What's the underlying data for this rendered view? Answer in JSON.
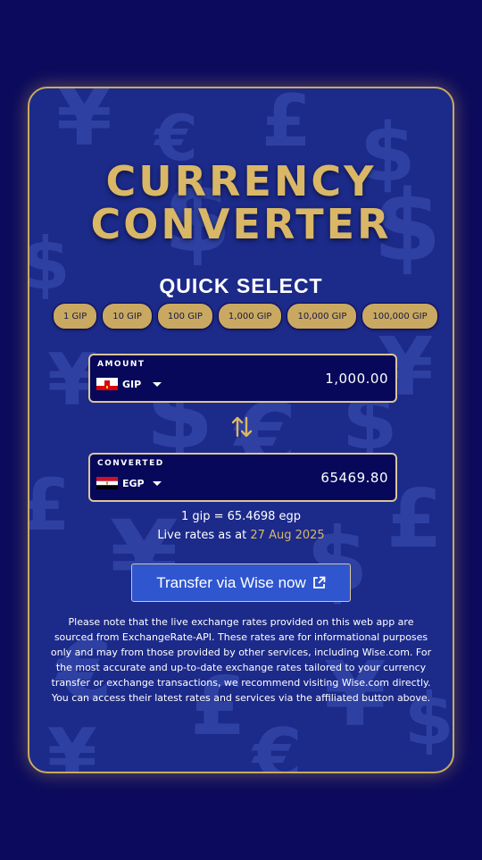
{
  "app": {
    "title_line1": "CURRENCY",
    "title_line2": "CONVERTER"
  },
  "quick_select": {
    "heading": "QUICK SELECT",
    "options": [
      "1 GIP",
      "10 GIP",
      "100 GIP",
      "1,000 GIP",
      "10,000 GIP",
      "100,000 GIP"
    ]
  },
  "amount": {
    "label": "AMOUNT",
    "currency_code": "GIP",
    "flag_icon": "gibraltar-flag",
    "value": "1,000.00"
  },
  "converted": {
    "label": "CONVERTED",
    "currency_code": "EGP",
    "flag_icon": "egypt-flag",
    "value": "65469.80"
  },
  "rate": {
    "text": "1 gip = 65.4698 egp",
    "live_prefix": "Live rates as at",
    "date": "27 Aug 2025"
  },
  "wise_button": {
    "label": "Transfer via Wise now",
    "icon": "external-link-icon"
  },
  "disclaimer": {
    "lines": [
      "Please note that the live exchange rates provided on this web app are",
      "sourced from ExchangeRate-API. These rates are for informational purposes",
      "only and may from those provided by other services, including Wise.com. For",
      "the most accurate and up-to-date exchange rates tailored to your currency",
      "transfer or exchange transactions, we recommend visiting Wise.com directly.",
      "You can access their latest rates and services via the affiliated button above."
    ]
  },
  "colors": {
    "page_bg": "#0b0a5c",
    "card_bg": "#1c2a8a",
    "gold": "#c9a961",
    "title_gold": "#d9b766",
    "button_blue": "#2f56cf"
  }
}
